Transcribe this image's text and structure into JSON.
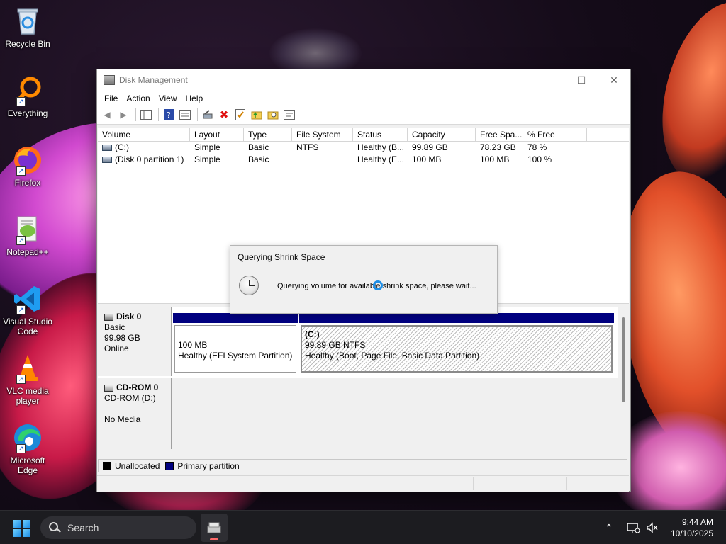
{
  "desktop": {
    "icons": [
      {
        "label": "Recycle Bin"
      },
      {
        "label": "Everything"
      },
      {
        "label": "Firefox"
      },
      {
        "label": "Notepad++"
      },
      {
        "label": "Visual Studio Code"
      },
      {
        "label": "VLC media player"
      },
      {
        "label": "Microsoft Edge"
      }
    ]
  },
  "window": {
    "title": "Disk Management",
    "menu": [
      "File",
      "Action",
      "View",
      "Help"
    ],
    "columns": [
      "Volume",
      "Layout",
      "Type",
      "File System",
      "Status",
      "Capacity",
      "Free Spa...",
      "% Free"
    ],
    "rows": [
      {
        "volume": "(C:)",
        "layout": "Simple",
        "type": "Basic",
        "fs": "NTFS",
        "status": "Healthy (B...",
        "capacity": "99.89 GB",
        "free": "78.23 GB",
        "pct": "78 %"
      },
      {
        "volume": "(Disk 0 partition 1)",
        "layout": "Simple",
        "type": "Basic",
        "fs": "",
        "status": "Healthy (E...",
        "capacity": "100 MB",
        "free": "100 MB",
        "pct": "100 %"
      }
    ],
    "disks": [
      {
        "name": "Disk 0",
        "kind": "Basic",
        "size": "99.98 GB",
        "state": "Online",
        "partitions": [
          {
            "title": "",
            "size": "100 MB",
            "status": "Healthy (EFI System Partition)"
          },
          {
            "title": "(C:)",
            "size": "99.89 GB NTFS",
            "status": "Healthy (Boot, Page File, Basic Data Partition)"
          }
        ]
      },
      {
        "name": "CD-ROM 0",
        "kind": "CD-ROM (D:)",
        "size": "",
        "state": "No Media"
      }
    ],
    "legend": [
      {
        "label": "Unallocated",
        "color": "#000000"
      },
      {
        "label": "Primary partition",
        "color": "#00007f"
      }
    ]
  },
  "dialog": {
    "title": "Querying Shrink Space",
    "message": "Querying volume for available shrink space, please wait..."
  },
  "taskbar": {
    "search_placeholder": "Search",
    "time": "9:44 AM",
    "date": "10/10/2025"
  },
  "colors": {
    "primary_partition": "#00007f",
    "unallocated": "#000000",
    "busy_cursor": "#1f8fe6"
  }
}
